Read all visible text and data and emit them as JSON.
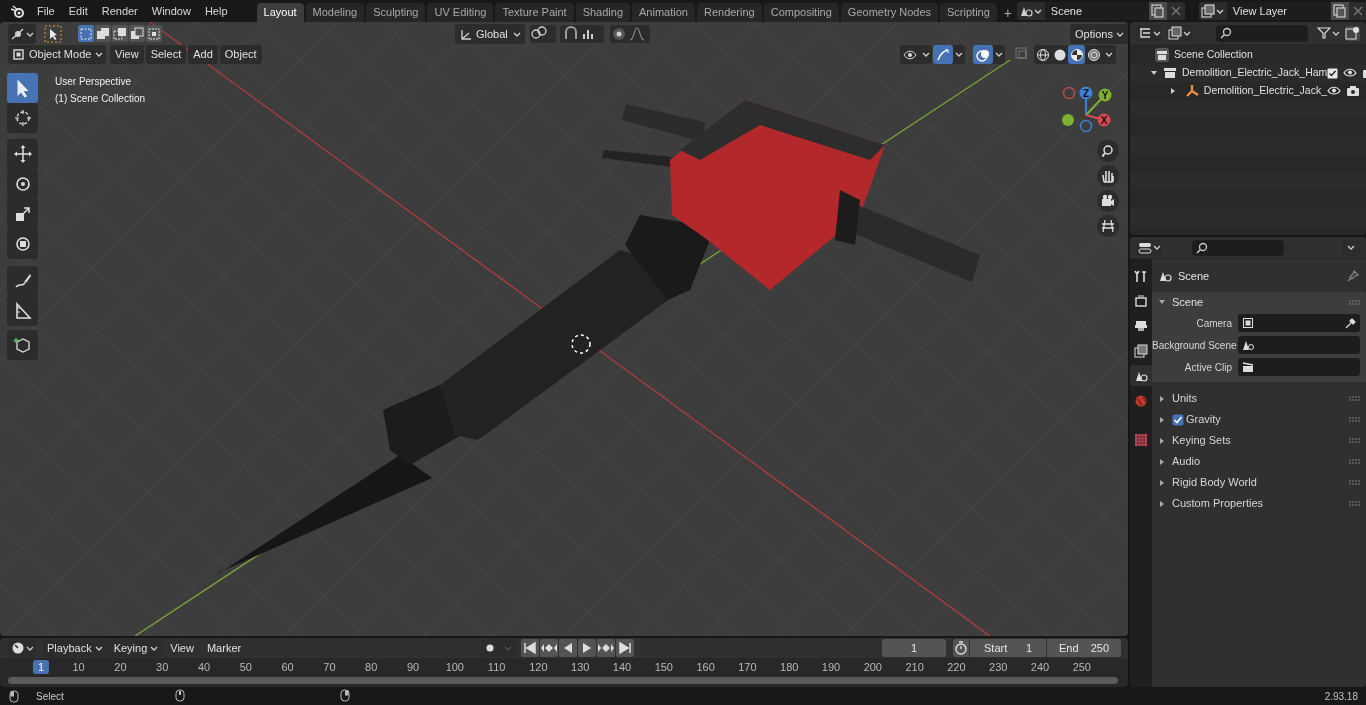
{
  "menu": [
    "File",
    "Edit",
    "Render",
    "Window",
    "Help"
  ],
  "workspaces": [
    {
      "label": "Layout",
      "selected": true
    },
    {
      "label": "Modeling",
      "selected": false
    },
    {
      "label": "Sculpting",
      "selected": false
    },
    {
      "label": "UV Editing",
      "selected": false
    },
    {
      "label": "Texture Paint",
      "selected": false
    },
    {
      "label": "Shading",
      "selected": false
    },
    {
      "label": "Animation",
      "selected": false
    },
    {
      "label": "Rendering",
      "selected": false
    },
    {
      "label": "Compositing",
      "selected": false
    },
    {
      "label": "Geometry Nodes",
      "selected": false
    },
    {
      "label": "Scripting",
      "selected": false
    }
  ],
  "add_workspace": "+",
  "scene": {
    "name": "Scene"
  },
  "view_layer": {
    "name": "View Layer"
  },
  "tool_header": {
    "orientation": "Global",
    "options": "Options"
  },
  "select_modes": [
    {
      "kind": "new",
      "selected": true
    },
    {
      "kind": "extend",
      "selected": false
    },
    {
      "kind": "subtract",
      "selected": false
    },
    {
      "kind": "invert",
      "selected": false
    },
    {
      "kind": "intersect",
      "selected": false
    }
  ],
  "viewport_header": {
    "mode": "Object Mode",
    "menus": [
      "View",
      "Select",
      "Add",
      "Object"
    ]
  },
  "viewport_toggles": {
    "gizmos": true,
    "overlays": true
  },
  "shading": [
    {
      "kind": "wireframe",
      "selected": false
    },
    {
      "kind": "solid",
      "selected": false
    },
    {
      "kind": "material",
      "selected": true
    },
    {
      "kind": "rendered",
      "selected": false
    }
  ],
  "viewport_info": [
    "User Perspective",
    "(1) Scene Collection"
  ],
  "toolbar": [
    {
      "kind": "select",
      "selected": true
    },
    {
      "kind": "cursor",
      "selected": false
    },
    {
      "kind": "move",
      "selected": false
    },
    {
      "kind": "rotate",
      "selected": false
    },
    {
      "kind": "scale",
      "selected": false
    },
    {
      "kind": "transform",
      "selected": false
    },
    {
      "kind": "annotate",
      "selected": false
    },
    {
      "kind": "measure",
      "selected": false
    },
    {
      "kind": "add-cube",
      "selected": false
    }
  ],
  "gizmo": {
    "x": "X",
    "y": "Y",
    "z": "Z"
  },
  "outliner": {
    "items": [
      {
        "label": "Scene Collection",
        "kind": "scene-collection",
        "children": [
          {
            "label": "Demolition_Electric_Jack_Ham",
            "kind": "collection",
            "expanded": true,
            "checked": true,
            "children": [
              {
                "label": "Demolition_Electric_Jack_",
                "kind": "armature",
                "expanded": false
              }
            ]
          }
        ]
      }
    ]
  },
  "properties": {
    "tabs": [
      {
        "kind": "tool",
        "selected": false
      },
      {
        "kind": "render",
        "selected": false
      },
      {
        "kind": "output",
        "selected": false
      },
      {
        "kind": "view-layer",
        "selected": false
      },
      {
        "kind": "scene",
        "selected": true
      },
      {
        "kind": "world",
        "selected": false
      },
      {
        "kind": "texture",
        "selected": false
      }
    ],
    "context": "Scene",
    "section": {
      "title": "Scene",
      "expanded": true,
      "fields": [
        {
          "label": "Camera",
          "kind": "camera"
        },
        {
          "label": "Background Scene",
          "kind": "scene"
        },
        {
          "label": "Active Clip",
          "kind": "clip"
        }
      ]
    },
    "panels": [
      {
        "label": "Units",
        "expanded": false
      },
      {
        "label": "Gravity",
        "expanded": false,
        "checked": true
      },
      {
        "label": "Keying Sets",
        "expanded": false
      },
      {
        "label": "Audio",
        "expanded": false
      },
      {
        "label": "Rigid Body World",
        "expanded": false
      },
      {
        "label": "Custom Properties",
        "expanded": false
      }
    ]
  },
  "timeline": {
    "menus": [
      "Playback",
      "Keying",
      "View",
      "Marker"
    ],
    "current_frame": "1",
    "start_label": "Start",
    "start": "1",
    "end_label": "End",
    "end": "250",
    "ruler": [
      {
        "label": "1",
        "selected": true
      },
      {
        "label": "10",
        "selected": false
      },
      {
        "label": "20",
        "selected": false
      },
      {
        "label": "30",
        "selected": false
      },
      {
        "label": "40",
        "selected": false
      },
      {
        "label": "50",
        "selected": false
      },
      {
        "label": "60",
        "selected": false
      },
      {
        "label": "70",
        "selected": false
      },
      {
        "label": "80",
        "selected": false
      },
      {
        "label": "90",
        "selected": false
      },
      {
        "label": "100",
        "selected": false
      },
      {
        "label": "110",
        "selected": false
      },
      {
        "label": "120",
        "selected": false
      },
      {
        "label": "130",
        "selected": false
      },
      {
        "label": "140",
        "selected": false
      },
      {
        "label": "150",
        "selected": false
      },
      {
        "label": "160",
        "selected": false
      },
      {
        "label": "170",
        "selected": false
      },
      {
        "label": "180",
        "selected": false
      },
      {
        "label": "190",
        "selected": false
      },
      {
        "label": "200",
        "selected": false
      },
      {
        "label": "210",
        "selected": false
      },
      {
        "label": "220",
        "selected": false
      },
      {
        "label": "230",
        "selected": false
      },
      {
        "label": "240",
        "selected": false
      },
      {
        "label": "250",
        "selected": false
      }
    ]
  },
  "status_bar": {
    "action": "Select",
    "version": "2.93.18"
  }
}
